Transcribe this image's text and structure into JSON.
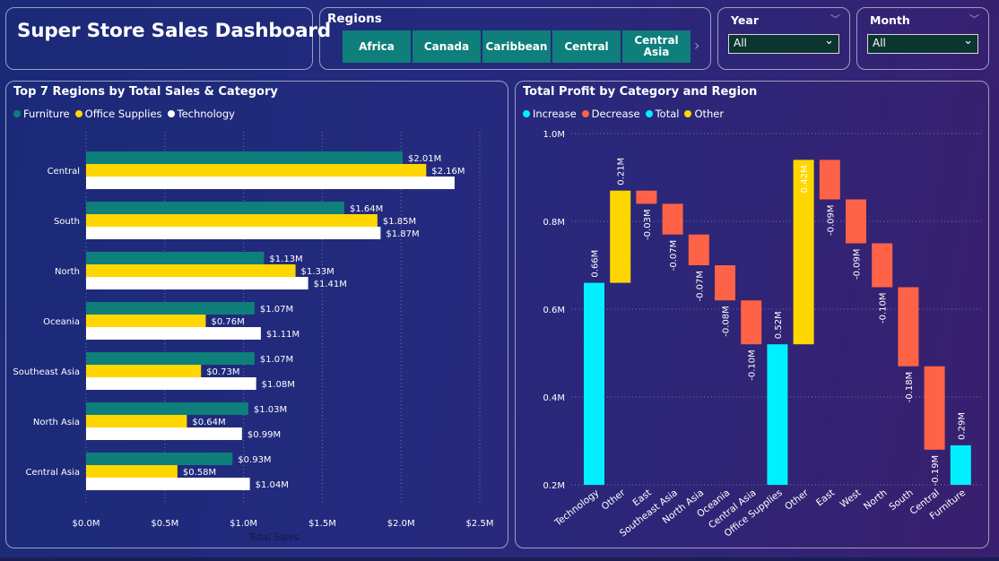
{
  "header": {
    "title": "Super Store Sales Dashboard"
  },
  "regions": {
    "label": "Regions",
    "tiles": [
      "Africa",
      "Canada",
      "Caribbean",
      "Central",
      "Central Asia"
    ]
  },
  "filters": {
    "year": {
      "label": "Year",
      "value": "All"
    },
    "month": {
      "label": "Month",
      "value": "All"
    }
  },
  "colors": {
    "furniture": "#0e7f7a",
    "office": "#ffd700",
    "technology": "#ffffff",
    "increase": "#00f0ff",
    "decrease": "#ff6347",
    "total": "#00f0ff",
    "other": "#ffd700"
  },
  "bar_chart": {
    "title": "Top 7 Regions by Total Sales & Category",
    "legend": [
      "Furniture",
      "Office Supplies",
      "Technology"
    ]
  },
  "waterfall": {
    "title": "Total Profit by Category and Region",
    "legend": [
      "Increase",
      "Decrease",
      "Total",
      "Other"
    ]
  },
  "chart_data": [
    {
      "type": "bar",
      "orientation": "horizontal",
      "title": "Top 7 Regions by Total Sales & Category",
      "categories": [
        "Central",
        "South",
        "North",
        "Oceania",
        "Southeast Asia",
        "North Asia",
        "Central Asia"
      ],
      "series": [
        {
          "name": "Furniture",
          "values": [
            2.01,
            1.64,
            1.13,
            1.07,
            1.07,
            1.03,
            0.93
          ],
          "labels": [
            "$2.01M",
            "$1.64M",
            "$1.13M",
            "$1.07M",
            "$1.07M",
            "$1.03M",
            "$0.93M"
          ]
        },
        {
          "name": "Office Supplies",
          "values": [
            2.16,
            1.85,
            1.33,
            0.76,
            0.73,
            0.64,
            0.58
          ],
          "labels": [
            "$2.16M",
            "$1.85M",
            "$1.33M",
            "$0.76M",
            "$0.73M",
            "$0.64M",
            "$0.58M"
          ]
        },
        {
          "name": "Technology",
          "values": [
            2.34,
            1.87,
            1.41,
            1.11,
            1.08,
            0.99,
            1.04
          ],
          "labels": [
            "",
            "$1.87M",
            "$1.41M",
            "$1.11M",
            "$1.08M",
            "$0.99M",
            "$1.04M"
          ]
        }
      ],
      "xlabel": "Total Sales",
      "xticks": [
        "$0.0M",
        "$0.5M",
        "$1.0M",
        "$1.5M",
        "$2.0M",
        "$2.5M"
      ],
      "xlim": [
        0,
        2.5
      ],
      "grid": true,
      "legend_position": "top-left"
    },
    {
      "type": "waterfall",
      "title": "Total Profit by Category and Region",
      "ylim": [
        0.2,
        1.0
      ],
      "yticks": [
        "0.2M",
        "0.4M",
        "0.6M",
        "0.8M",
        "1.0M"
      ],
      "ylabel": "",
      "grid": true,
      "legend_position": "top-left",
      "steps": [
        {
          "label": "Technology",
          "kind": "total",
          "start": 0,
          "end": 0.66,
          "text": "0.66M"
        },
        {
          "label": "Other",
          "kind": "other",
          "start": 0.66,
          "end": 0.87,
          "text": "0.21M"
        },
        {
          "label": "East",
          "kind": "decrease",
          "start": 0.87,
          "end": 0.84,
          "text": "-0.03M"
        },
        {
          "label": "Southeast Asia",
          "kind": "decrease",
          "start": 0.84,
          "end": 0.77,
          "text": "-0.07M"
        },
        {
          "label": "North Asia",
          "kind": "decrease",
          "start": 0.77,
          "end": 0.7,
          "text": "-0.07M"
        },
        {
          "label": "Oceania",
          "kind": "decrease",
          "start": 0.7,
          "end": 0.62,
          "text": "-0.08M"
        },
        {
          "label": "Central Asia",
          "kind": "decrease",
          "start": 0.62,
          "end": 0.52,
          "text": "-0.10M"
        },
        {
          "label": "Office Supplies",
          "kind": "total",
          "start": 0,
          "end": 0.52,
          "text": "0.52M"
        },
        {
          "label": "Other",
          "kind": "other",
          "start": 0.52,
          "end": 0.94,
          "text": "0.42M"
        },
        {
          "label": "East",
          "kind": "decrease",
          "start": 0.94,
          "end": 0.85,
          "text": "-0.09M"
        },
        {
          "label": "West",
          "kind": "decrease",
          "start": 0.85,
          "end": 0.75,
          "text": "-0.09M"
        },
        {
          "label": "North",
          "kind": "decrease",
          "start": 0.75,
          "end": 0.65,
          "text": "-0.10M"
        },
        {
          "label": "South",
          "kind": "decrease",
          "start": 0.65,
          "end": 0.47,
          "text": "-0.18M"
        },
        {
          "label": "Central",
          "kind": "decrease",
          "start": 0.47,
          "end": 0.28,
          "text": "-0.19M"
        },
        {
          "label": "Furniture",
          "kind": "total",
          "start": 0,
          "end": 0.29,
          "text": "0.29M"
        }
      ]
    }
  ]
}
